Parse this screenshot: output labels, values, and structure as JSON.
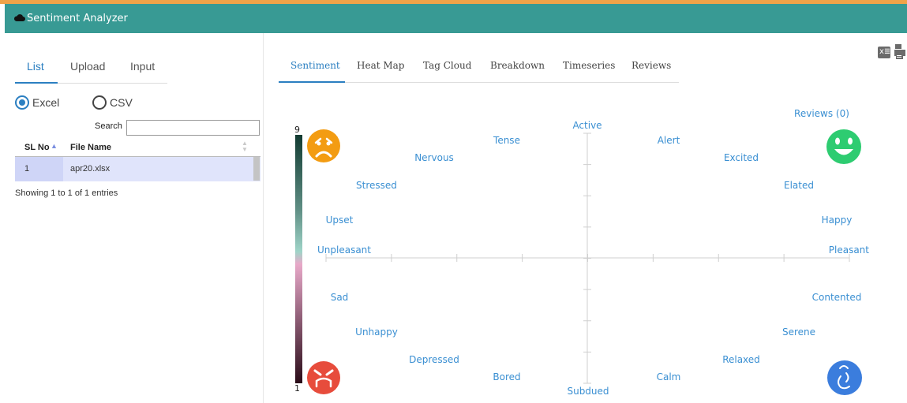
{
  "app": {
    "title": "Sentiment Analyzer",
    "icon": "cloud-icon"
  },
  "colors": {
    "header": "#389a94",
    "accent_line": "#f0a349",
    "link": "#2b7fc1",
    "label": "#3a8fd2"
  },
  "left_tabs": [
    {
      "label": "List",
      "active": true
    },
    {
      "label": "Upload",
      "active": false
    },
    {
      "label": "Input",
      "active": false
    }
  ],
  "file_type": [
    {
      "label": "Excel",
      "checked": true
    },
    {
      "label": "CSV",
      "checked": false
    }
  ],
  "search": {
    "label": "Search",
    "value": ""
  },
  "table": {
    "headers": [
      "SL No",
      "File Name"
    ],
    "rows": [
      {
        "sl": "1",
        "file": "apr20.xlsx"
      }
    ],
    "info": "Showing 1 to 1 of 1 entries"
  },
  "right_tabs": [
    {
      "label": "Sentiment",
      "active": true
    },
    {
      "label": "Heat Map",
      "active": false
    },
    {
      "label": "Tag Cloud",
      "active": false
    },
    {
      "label": "Breakdown",
      "active": false
    },
    {
      "label": "Timeseries",
      "active": false
    },
    {
      "label": "Reviews",
      "active": false
    }
  ],
  "toolbar": {
    "excel_icon": "excel-icon",
    "excel_text": "x≣",
    "print_icon": "print-icon"
  },
  "sentiment": {
    "reviews_label": "Reviews (0)",
    "color_scale": {
      "max": "9",
      "min": "1"
    },
    "axis": {
      "top": "Active",
      "bottom": "Subdued",
      "left": "Unpleasant",
      "right": "Pleasant"
    },
    "words": {
      "tense": "Tense",
      "nervous": "Nervous",
      "stressed": "Stressed",
      "upset": "Upset",
      "alert": "Alert",
      "excited": "Excited",
      "elated": "Elated",
      "happy": "Happy",
      "sad": "Sad",
      "unhappy": "Unhappy",
      "depressed": "Depressed",
      "bored": "Bored",
      "calm": "Calm",
      "relaxed": "Relaxed",
      "serene": "Serene",
      "contented": "Contented"
    },
    "faces": {
      "top_left": {
        "icon": "worried-face-icon",
        "color": "#f39c12"
      },
      "top_right": {
        "icon": "happy-face-icon",
        "color": "#2ecc71"
      },
      "bottom_left": {
        "icon": "angry-face-icon",
        "color": "#e74c3c"
      },
      "bottom_right": {
        "icon": "relaxed-face-icon",
        "color": "#3b7ddd"
      }
    }
  }
}
